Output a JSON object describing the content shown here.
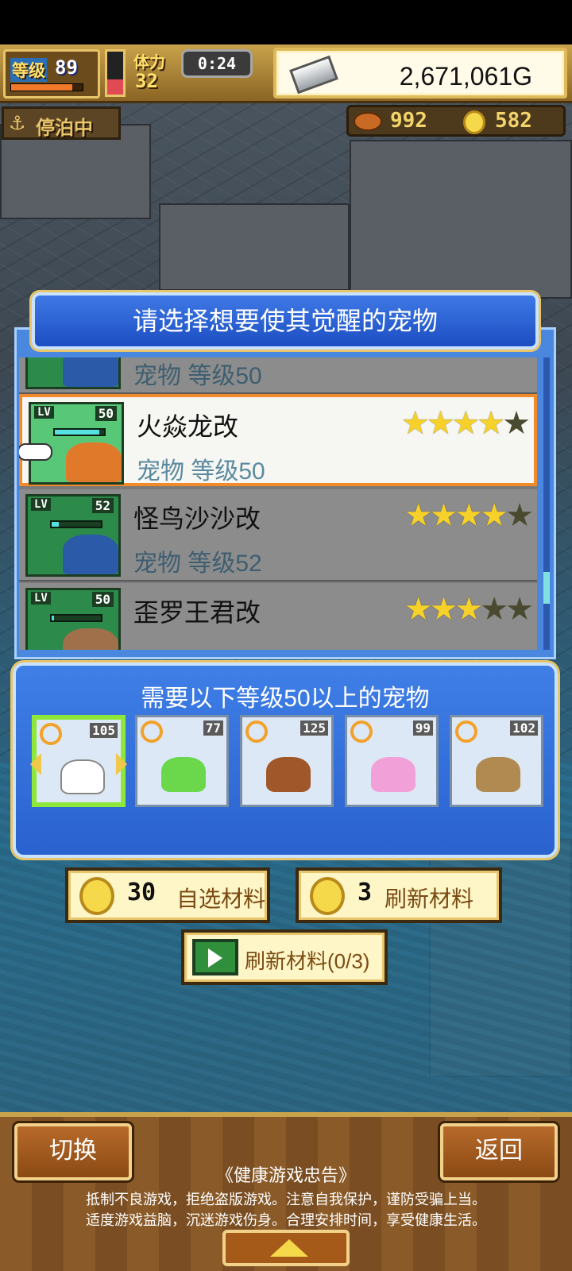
{
  "hud": {
    "level_label": "等级",
    "level_value": "89",
    "exp_progress": 0.85,
    "stamina_label": "体力",
    "stamina_value": "32",
    "stamina_fill": 0.35,
    "timer": "0:24",
    "money": "2,671,061G",
    "dock_status": "停泊中",
    "meat": "992",
    "coins": "582"
  },
  "dialog": {
    "title": "请选择想要使其觉醒的宠物",
    "pets": [
      {
        "name": "",
        "subtitle": "宠物 等级50",
        "lv": "50",
        "stars": 0,
        "art_color": "#2a5aa8"
      },
      {
        "name": "火焱龙改",
        "subtitle": "宠物 等级50",
        "lv": "50",
        "stars": 4,
        "art_color": "#e07a2a",
        "selected": true
      },
      {
        "name": "怪鸟沙沙改",
        "subtitle": "宠物 等级52",
        "lv": "52",
        "stars": 4,
        "art_color": "#2a5aa8"
      },
      {
        "name": "歪罗王君改",
        "subtitle": "",
        "lv": "50",
        "stars": 3,
        "art_color": "#a0704a"
      }
    ],
    "max_stars": 5
  },
  "requirements": {
    "title": "需要以下等级50以上的宠物",
    "materials": [
      {
        "num": "105",
        "art_color": "#ffffff",
        "active": true
      },
      {
        "num": "77",
        "art_color": "#6ad84a"
      },
      {
        "num": "125",
        "art_color": "#a0582a"
      },
      {
        "num": "99",
        "art_color": "#f2a0d8"
      },
      {
        "num": "102",
        "art_color": "#b08a50"
      }
    ]
  },
  "buttons": {
    "choose_num": "30",
    "choose_label": "自选材料",
    "refresh_num": "3",
    "refresh_label": "刷新材料",
    "video_label": "刷新材料(0/3)",
    "switch_label": "切换",
    "back_label": "返回"
  },
  "advice": {
    "title": "《健康游戏忠告》",
    "line1": "抵制不良游戏，拒绝盗版游戏。注意自我保护，谨防受骗上当。",
    "line2": "适度游戏益脑，沉迷游戏伤身。合理安排时间，享受健康生活。"
  }
}
